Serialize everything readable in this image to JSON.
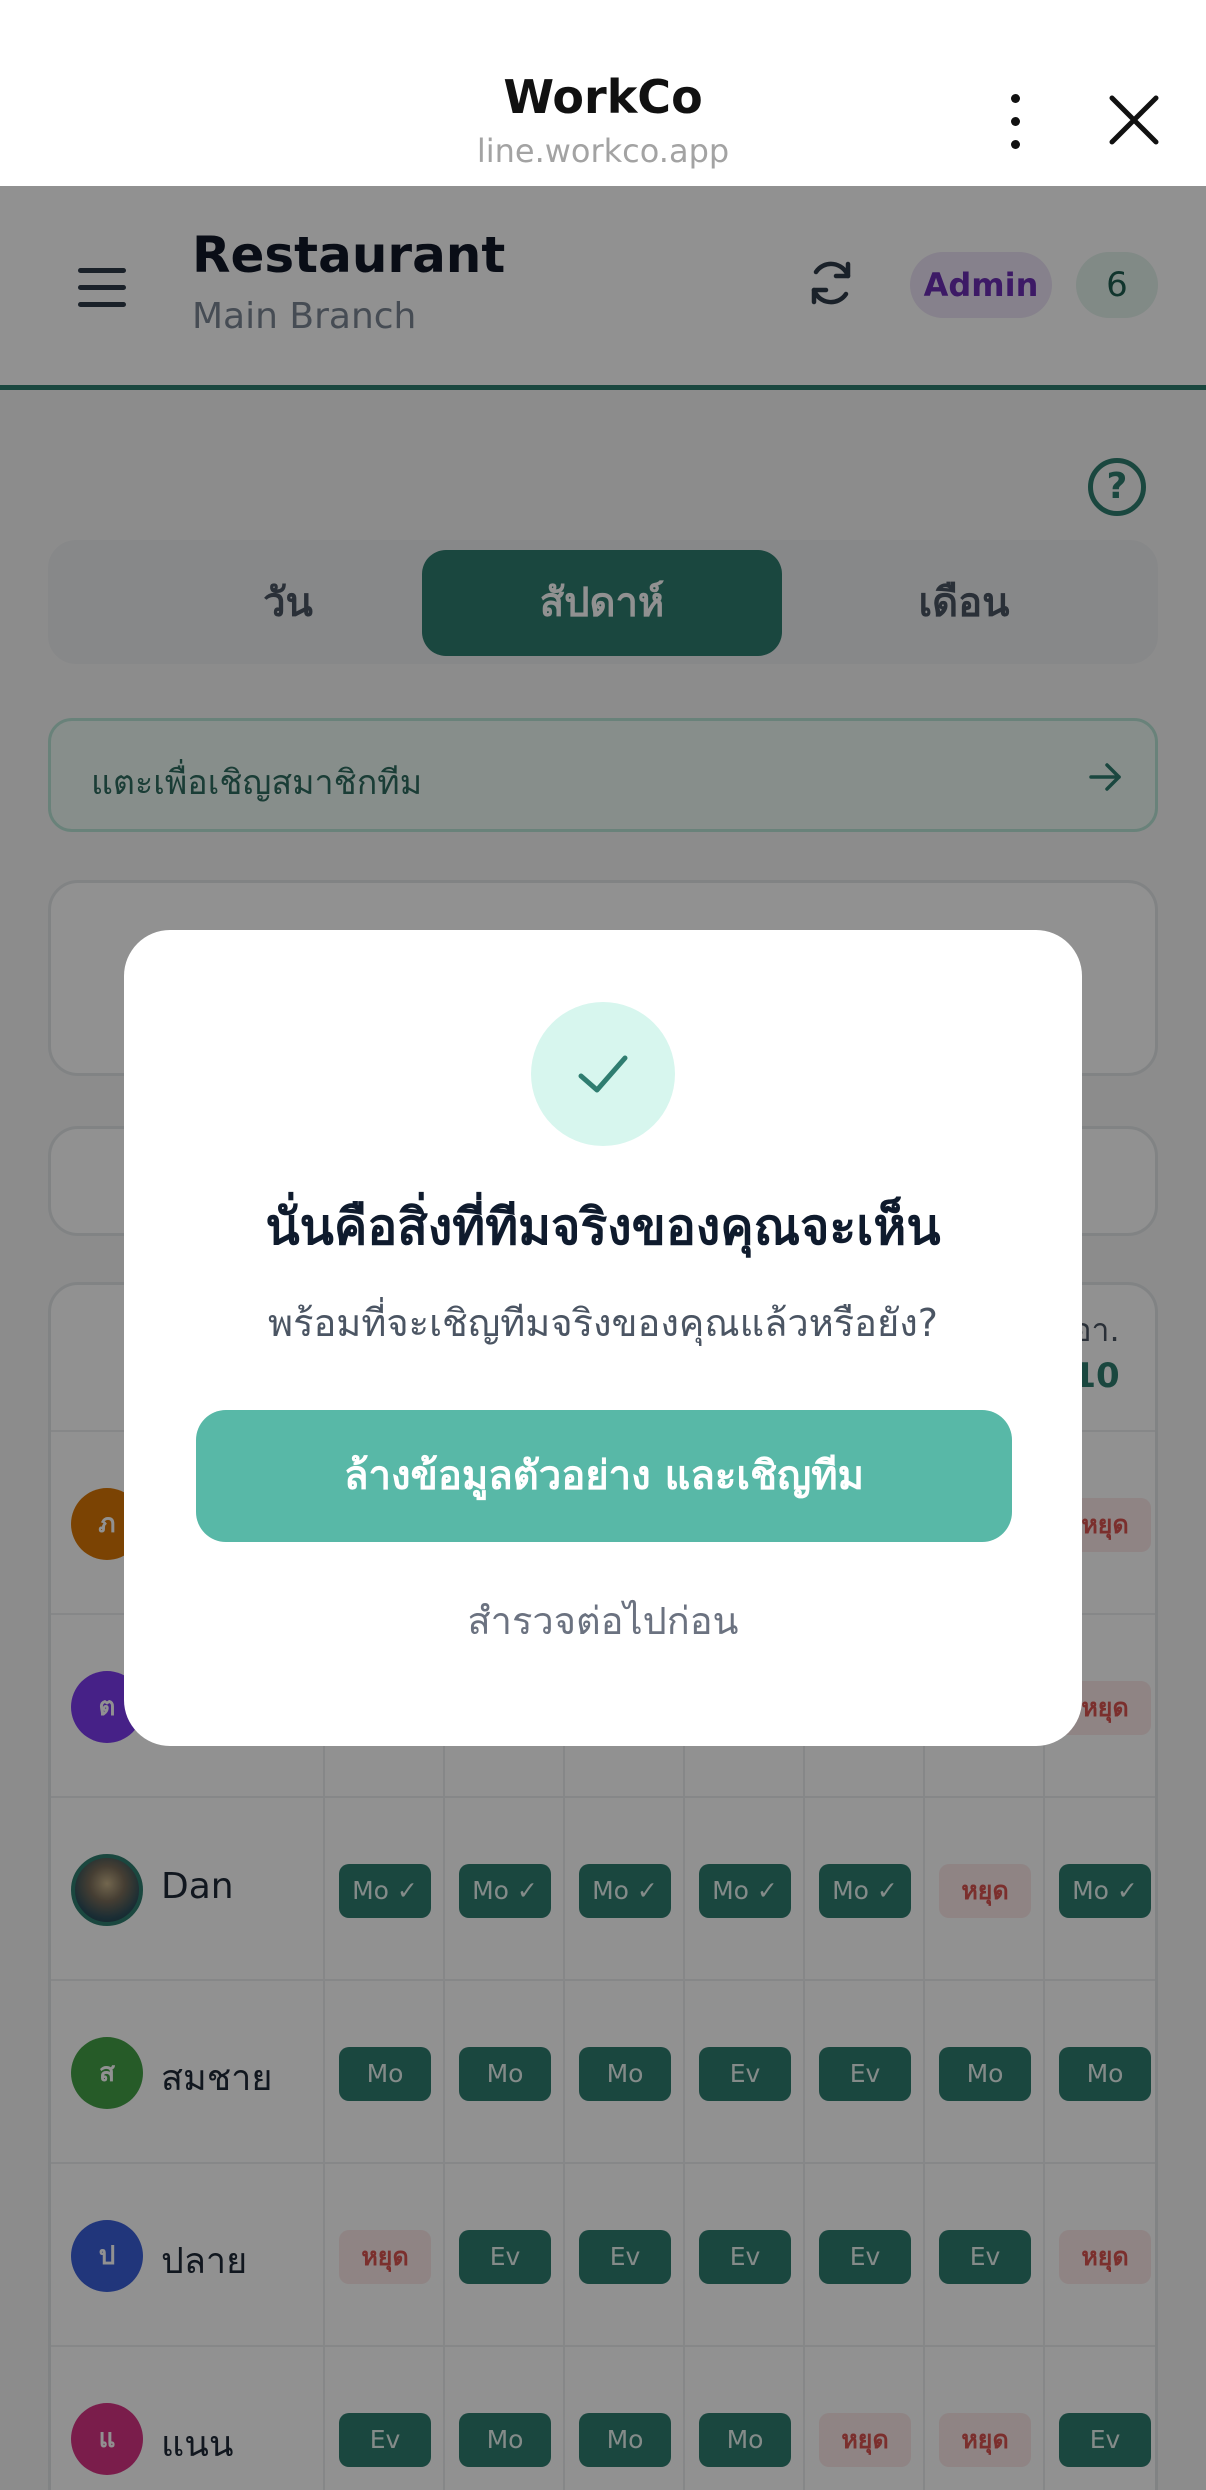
{
  "browser": {
    "title": "WorkCo",
    "url": "line.workco.app",
    "more_icon": "more-vertical-icon",
    "close_icon": "close-icon"
  },
  "header": {
    "title": "Restaurant",
    "subtitle": "Main Branch",
    "role_badge": "Admin",
    "count_badge": "6",
    "menu_icon": "hamburger-icon",
    "refresh_icon": "refresh-icon"
  },
  "help_icon": {
    "icon": "help-circle-icon",
    "glyph": "?"
  },
  "tabs": [
    {
      "label": "วัน",
      "active": false
    },
    {
      "label": "สัปดาห์",
      "active": true
    },
    {
      "label": "เดือน",
      "active": false
    }
  ],
  "invite_bar": {
    "label": "แตะเพื่อเชิญสมาชิกทีม",
    "icon": "arrow-right-icon"
  },
  "schedule": {
    "last_day_name": "อา.",
    "last_day_date": "10",
    "rows": [
      {
        "initial": "ภ",
        "name": "",
        "avatar_color": "#d97706",
        "shifts": [
          "",
          "",
          "",
          "",
          "",
          "",
          "หยุด"
        ]
      },
      {
        "initial": "ต",
        "name": "",
        "avatar_color": "#7c3aed",
        "shifts": [
          "",
          "",
          "",
          "",
          "",
          "",
          "หยุด"
        ]
      },
      {
        "initial": "",
        "name": "Dan",
        "avatar_color": "photo",
        "shifts": [
          "Mo ✓",
          "Mo ✓",
          "Mo ✓",
          "Mo ✓",
          "Mo ✓",
          "หยุด",
          "Mo ✓"
        ]
      },
      {
        "initial": "ส",
        "name": "สมชาย",
        "avatar_color": "#43a047",
        "shifts": [
          "Mo",
          "Mo",
          "Mo",
          "Ev",
          "Ev",
          "Mo",
          "Mo"
        ]
      },
      {
        "initial": "ป",
        "name": "ปลาย",
        "avatar_color": "#3b5fd9",
        "shifts": [
          "หยุด",
          "Ev",
          "Ev",
          "Ev",
          "Ev",
          "Ev",
          "หยุด"
        ]
      },
      {
        "initial": "แ",
        "name": "แนน",
        "avatar_color": "#d63384",
        "shifts": [
          "Ev",
          "Mo",
          "Mo",
          "Mo",
          "หยุด",
          "หยุด",
          "Ev"
        ]
      }
    ]
  },
  "modal": {
    "icon": "check-icon",
    "title": "นั่นคือสิ่งที่ทีมจริงของคุณจะเห็น",
    "text": "พร้อมที่จะเชิญทีมจริงของคุณแล้วหรือยัง?",
    "primary_label": "ล้างข้อมูลตัวอย่าง และเชิญทีม",
    "secondary_label": "สำรวจต่อไปก่อน"
  },
  "colors": {
    "brand": "#2f7d70",
    "primary_button": "#58b8a7",
    "off_chip_text": "#d9534f",
    "admin_badge": "#6b2fb3"
  }
}
